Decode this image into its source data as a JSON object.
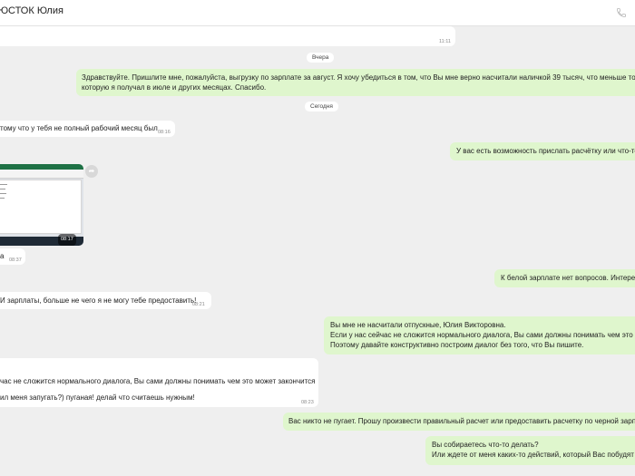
{
  "header": {
    "title": "ЮСТОК Юлия",
    "phone_icon": "phone-icon"
  },
  "messages": {
    "m1": {
      "time": "11:11"
    },
    "sep1": {
      "label": "Вчера"
    },
    "m2": {
      "line1": "Здравствуйте. Пришлите мне, пожалуйста, выгрузку по зарплате за август. Я хочу убедиться в том, что Вы мне верно насчитали наличкой 39 тысяч, что меньше той за",
      "line2": "которую я получал в июле и других месяцах. Спасибо."
    },
    "sep2": {
      "label": "Сегодня"
    },
    "m3": {
      "text": "тому что у тебя не полный рабочий месяц был",
      "time": "08:16"
    },
    "m4": {
      "text": "У вас есть возможность прислать расчётку или что-то"
    },
    "m5": {
      "image_time": "08:17"
    },
    "m6": {
      "text": "а",
      "time": "08:37"
    },
    "m7": {
      "text": "К белой зарплате нет вопросов. Интерес"
    },
    "m8": {
      "text": "И зарплаты, больше не чего я не могу тебе предоставить!",
      "time": "08:21"
    },
    "m9": {
      "line1": "Вы мне не насчитали отпускные, Юлия Викторовна.",
      "line2": "Если у нас сейчас не сложится нормального диалога, Вы сами должны понимать чем это м",
      "line3": "Поэтому давайте конструктивно построим диалог без того, что Вы пишите."
    },
    "m10": {
      "line1": "час не сложится нормального диалога, Вы сами должны понимать чем это может закончится",
      "line2": "ил меня запугать?) пуганая! делай что считаешь нужным!",
      "time": "08:23"
    },
    "m11": {
      "text": "Вас никто не пугает. Прошу произвести правильный расчет или предоставить расчетку по черной зарпл"
    },
    "m12": {
      "line1": "Вы собираетесь что-то делать?",
      "line2": "Или ждете от меня каких-то действий, который Вас побудят к"
    }
  },
  "colors": {
    "incoming": "#ffffff",
    "outgoing": "#dff6cd",
    "background": "#efefef",
    "excel": "#1e7145"
  }
}
